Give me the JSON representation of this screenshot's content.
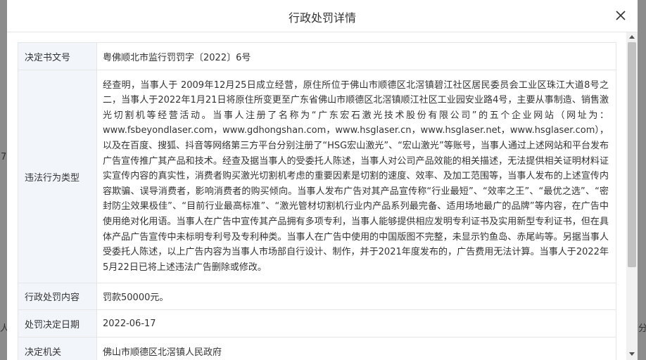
{
  "modal": {
    "title": "行政处罚详情"
  },
  "rows": [
    {
      "label": "决定书文号",
      "value": "粤佛顺北市监行罚罚字〔2022〕6号"
    },
    {
      "label": "违法行为类型",
      "value": "经查明，当事人于 2009年12月25日成立经营，原住所位于佛山市顺德区北滘镇碧江社区居民委员会工业区珠江大道8号之二，当事人于2022年1月21日将原住所变更至广东省佛山市顺德区北滘镇顺江社区工业园安业路4号，主要从事制造、销售激光切割机等经营活动。当事人注册了名称为“广东宏石激光技术股份有限公司”的五个企业网站（网址为：www.fsbeyondlaser.com，www.gdhongshan.com，www.hsglaser.cn，www.hsglaser.net，www.hsglaser.com），以及在百度、搜狐、抖音等网络第三方平台分别注册了“HSG宏山激光”、“宏山激光”等账号，当事人通过上述网站和平台发布广告宣传推广其产品和技术。经查及据当事人的受委托人陈述，当事人对公司产品效能的相关描述，无法提供相关证明材料证实宣传内容的真实性，消费者购买激光切割机考虑的重要因素是切割的速度、效率、及加工范围等，当事人发布的上述宣传内容欺骗、误导消费者，影响消费者的购买倾向。当事人发布广告对其产品宣传称“行业最短”、“效率之王”、“最优之选”、“密封防尘效果极佳”、“目前行业最高标准”、“激光管材切割机行业内产品系列最完备、适用场地最广的品牌”等内容，在广告中使用绝对化用语。当事人在广告中宣传其产品拥有多项专利，当事人能够提供相应发明专利证书及实用新型专利证书，但在具体产品广告宣传中未标明专利号及专利种类。当事人在广告中使用的中国版图不完整，未显示钓鱼岛、赤尾屿等。另据当事人受委托人陈述，以上广告内容为当事人市场部自行设计、制作，并于2021年度发布的，广告费用无法计算。当事人于2022年5月22日已将上述违法广告删除或修改。"
    },
    {
      "label": "行政处罚内容",
      "value": "罚款50000元。"
    },
    {
      "label": "处罚决定日期",
      "value": "2022-06-17"
    },
    {
      "label": "决定机关",
      "value": "佛山市顺德区北滘镇人民政府"
    }
  ],
  "background_fragments": {
    "left_top": "7",
    "left_bottom": "人",
    "right_bottom": "分"
  }
}
